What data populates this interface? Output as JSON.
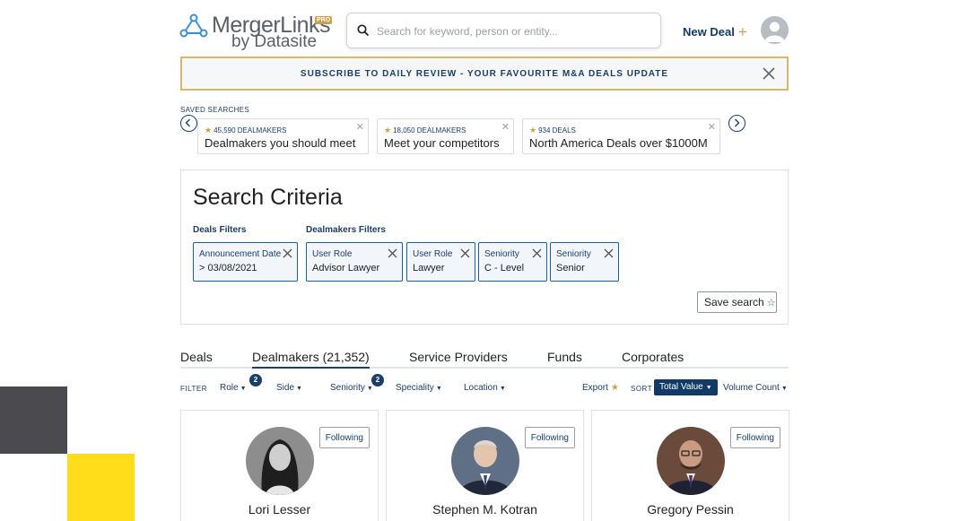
{
  "brand": {
    "name": "MergerLinks",
    "badge": "PRO",
    "byline": "by Datasite",
    "accent": "#c9a24a",
    "primary": "#123a66"
  },
  "search": {
    "placeholder": "Search for keyword, person or entity...",
    "value": "",
    "icon": "search-icon"
  },
  "header": {
    "new_deal_label": "New Deal",
    "new_deal_icon": "+",
    "avatar_icon": "user-avatar-icon"
  },
  "banner": {
    "text": "SUBSCRIBE TO DAILY REVIEW - YOUR FAVOURITE M&A DEALS UPDATE",
    "close_icon": "close-icon"
  },
  "saved_searches": {
    "label": "SAVED SEARCHES",
    "items": [
      {
        "count": "45,590 DEALMAKERS",
        "title": "Dealmakers you should meet"
      },
      {
        "count": "18,050 DEALMAKERS",
        "title": "Meet your competitors"
      },
      {
        "count": "934 DEALS",
        "title": "North America Deals over $1000M"
      }
    ]
  },
  "criteria": {
    "title": "Search Criteria",
    "deals_filters_label": "Deals Filters",
    "dealmakers_filters_label": "Dealmakers Filters",
    "deals_filters": [
      {
        "key": "Announcement Date",
        "value": "> 03/08/2021"
      }
    ],
    "dealmakers_filters": [
      {
        "key": "User Role",
        "value": "Advisor Lawyer"
      },
      {
        "key": "User Role",
        "value": "Lawyer"
      },
      {
        "key": "Seniority",
        "value": "C - Level"
      },
      {
        "key": "Seniority",
        "value": "Senior"
      }
    ],
    "save_label": "Save search"
  },
  "tabs": [
    {
      "label": "Deals",
      "active": false
    },
    {
      "label": "Dealmakers (21,352)",
      "active": true
    },
    {
      "label": "Service Providers",
      "active": false
    },
    {
      "label": "Funds",
      "active": false
    },
    {
      "label": "Corporates",
      "active": false
    }
  ],
  "filter_bar": {
    "filter_label": "FILTER",
    "filters": [
      {
        "label": "Role",
        "badge": "2"
      },
      {
        "label": "Side",
        "badge": ""
      },
      {
        "label": "Seniority",
        "badge": "2"
      },
      {
        "label": "Speciality",
        "badge": ""
      },
      {
        "label": "Location",
        "badge": ""
      }
    ],
    "export_label": "Export",
    "sort_label": "SORT",
    "sort_active": "Total Value",
    "sort_other": "Volume Count"
  },
  "people": [
    {
      "name": "Lori Lesser",
      "follow_label": "Following"
    },
    {
      "name": "Stephen M. Kotran",
      "follow_label": "Following"
    },
    {
      "name": "Gregory Pessin",
      "follow_label": "Following"
    }
  ]
}
